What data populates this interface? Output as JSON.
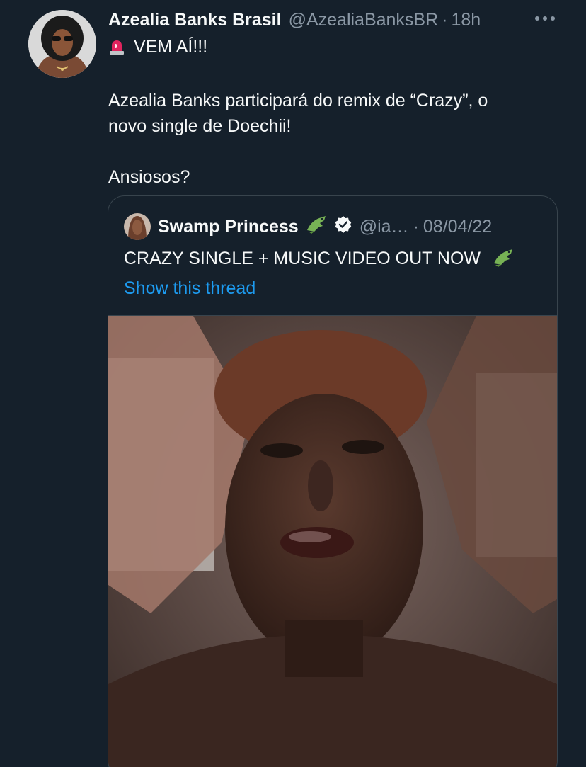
{
  "tweet": {
    "display_name": "Azealia Banks Brasil",
    "handle": "@AzealiaBanksBR",
    "separator": "·",
    "time": "18h",
    "more_icon": "more-horizontal-icon",
    "lines": [
      "VEM AÍ!!!",
      "Azealia Banks participará do remix de “Crazy”, o",
      "novo single de Doechii!",
      "Ansiosos?"
    ]
  },
  "quote": {
    "display_name": "Swamp Princess",
    "handle": "@ia…",
    "separator": "·",
    "date": "08/04/22",
    "text": "CRAZY SINGLE + MUSIC VIDEO OUT NOW",
    "link": "Show this thread"
  },
  "colors": {
    "background": "#15202b",
    "text": "#f7f9f9",
    "secondary": "#8b98a5",
    "link": "#1d9bf0",
    "border": "#38444d"
  }
}
